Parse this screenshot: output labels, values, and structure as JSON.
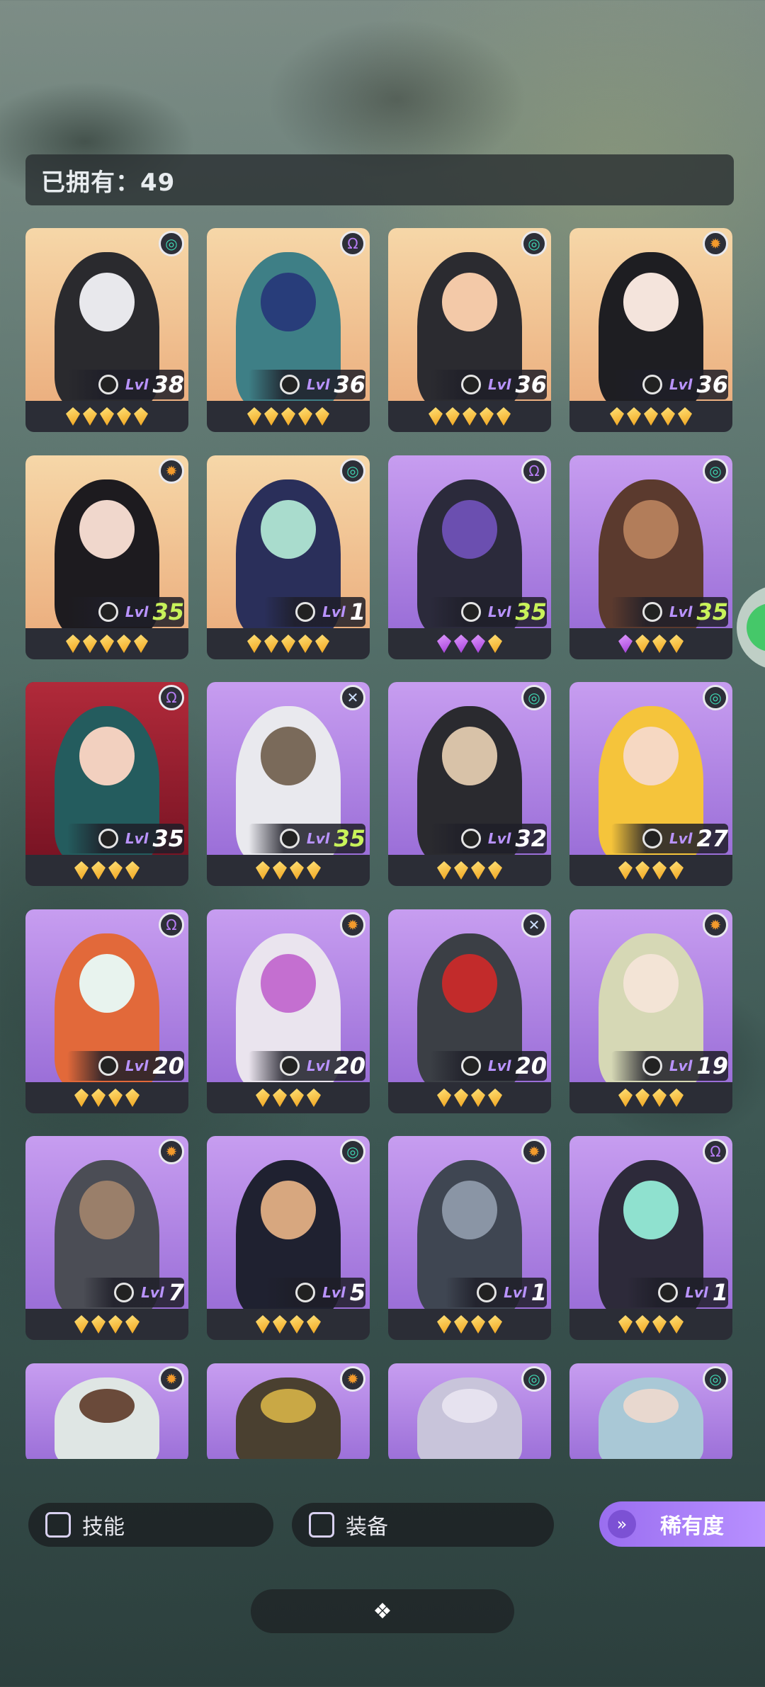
{
  "header": {
    "owned_text": "已拥有：49"
  },
  "cards": [
    {
      "element": "green",
      "level": "38",
      "hi": false,
      "gems": [
        "gold",
        "gold",
        "gold",
        "gold",
        "gold"
      ],
      "bg": [
        "#f6d7a8",
        "#ecb080"
      ],
      "fig": "#2a2a2e",
      "face": "#e8e8ec"
    },
    {
      "element": "purple",
      "level": "36",
      "hi": false,
      "gems": [
        "gold",
        "gold",
        "gold",
        "gold",
        "gold"
      ],
      "bg": [
        "#f6d7a8",
        "#ecb080"
      ],
      "fig": "#3e7f86",
      "face": "#283d7a"
    },
    {
      "element": "green",
      "level": "36",
      "hi": false,
      "gems": [
        "gold",
        "gold",
        "gold",
        "gold",
        "gold"
      ],
      "bg": [
        "#f6d7a8",
        "#ecb080"
      ],
      "fig": "#2b2b30",
      "face": "#f3c9a8"
    },
    {
      "element": "orange",
      "level": "36",
      "hi": false,
      "gems": [
        "gold",
        "gold",
        "gold",
        "gold",
        "gold"
      ],
      "bg": [
        "#f6d7a8",
        "#ecb080"
      ],
      "fig": "#1e1e22",
      "face": "#f4e4dc"
    },
    {
      "element": "orange",
      "level": "35",
      "hi": true,
      "gems": [
        "gold",
        "gold",
        "gold",
        "gold",
        "gold"
      ],
      "bg": [
        "#f6d7a8",
        "#ecb080"
      ],
      "fig": "#1d1b1f",
      "face": "#f0d7cc"
    },
    {
      "element": "green",
      "level": "1",
      "hi": false,
      "gems": [
        "gold",
        "gold",
        "gold",
        "gold",
        "gold"
      ],
      "bg": [
        "#f6d7a8",
        "#ecb080"
      ],
      "fig": "#2a2f5a",
      "face": "#a9dccd"
    },
    {
      "element": "purple",
      "level": "35",
      "hi": true,
      "gems": [
        "purple",
        "purple",
        "purple",
        "gold"
      ],
      "bg": [
        "#c79df0",
        "#9b6fd8"
      ],
      "fig": "#2b2a3b",
      "face": "#6b4fb0"
    },
    {
      "element": "green",
      "level": "35",
      "hi": true,
      "gems": [
        "purple",
        "gold",
        "gold",
        "gold"
      ],
      "bg": [
        "#c79df0",
        "#9b6fd8"
      ],
      "fig": "#5b3a2e",
      "face": "#b27d5a"
    },
    {
      "element": "purple",
      "level": "35",
      "hi": false,
      "gems": [
        "gold",
        "gold",
        "gold",
        "gold"
      ],
      "bg": [
        "#b12a3a",
        "#7a1424"
      ],
      "fig": "#245c5e",
      "face": "#f2d0bf"
    },
    {
      "element": "blue",
      "level": "35",
      "hi": true,
      "gems": [
        "gold",
        "gold",
        "gold",
        "gold"
      ],
      "bg": [
        "#c79df0",
        "#9b6fd8"
      ],
      "fig": "#e9e9ee",
      "face": "#7a6a5a"
    },
    {
      "element": "green",
      "level": "32",
      "hi": false,
      "gems": [
        "gold",
        "gold",
        "gold",
        "gold"
      ],
      "bg": [
        "#c79df0",
        "#9b6fd8"
      ],
      "fig": "#2a2a2f",
      "face": "#d8c2a8"
    },
    {
      "element": "green",
      "level": "27",
      "hi": false,
      "gems": [
        "gold",
        "gold",
        "gold",
        "gold"
      ],
      "bg": [
        "#c79df0",
        "#9b6fd8"
      ],
      "fig": "#f5c43b",
      "face": "#f6d8c2"
    },
    {
      "element": "purple",
      "level": "20",
      "hi": false,
      "gems": [
        "gold",
        "gold",
        "gold",
        "gold"
      ],
      "bg": [
        "#c79df0",
        "#9b6fd8"
      ],
      "fig": "#e2693a",
      "face": "#e8f3ee"
    },
    {
      "element": "orange",
      "level": "20",
      "hi": false,
      "gems": [
        "gold",
        "gold",
        "gold",
        "gold"
      ],
      "bg": [
        "#c79df0",
        "#9b6fd8"
      ],
      "fig": "#eae4ee",
      "face": "#c46fd0"
    },
    {
      "element": "blue",
      "level": "20",
      "hi": false,
      "gems": [
        "gold",
        "gold",
        "gold",
        "gold"
      ],
      "bg": [
        "#c79df0",
        "#9b6fd8"
      ],
      "fig": "#3b3f45",
      "face": "#c22b2b"
    },
    {
      "element": "orange",
      "level": "19",
      "hi": false,
      "gems": [
        "gold",
        "gold",
        "gold",
        "gold"
      ],
      "bg": [
        "#c79df0",
        "#9b6fd8"
      ],
      "fig": "#d6d8b5",
      "face": "#f3e4d6"
    },
    {
      "element": "orange",
      "level": "7",
      "hi": false,
      "gems": [
        "gold",
        "gold",
        "gold",
        "gold"
      ],
      "bg": [
        "#c79df0",
        "#9b6fd8"
      ],
      "fig": "#4b4d55",
      "face": "#9a7f6a"
    },
    {
      "element": "green",
      "level": "5",
      "hi": false,
      "gems": [
        "gold",
        "gold",
        "gold",
        "gold"
      ],
      "bg": [
        "#c79df0",
        "#9b6fd8"
      ],
      "fig": "#1f2130",
      "face": "#d7a77f"
    },
    {
      "element": "orange",
      "level": "1",
      "hi": false,
      "gems": [
        "gold",
        "gold",
        "gold",
        "gold"
      ],
      "bg": [
        "#c79df0",
        "#9b6fd8"
      ],
      "fig": "#3f4652",
      "face": "#8a95a5"
    },
    {
      "element": "purple",
      "level": "1",
      "hi": false,
      "gems": [
        "gold",
        "gold",
        "gold",
        "gold"
      ],
      "bg": [
        "#c79df0",
        "#9b6fd8"
      ],
      "fig": "#2d2a3a",
      "face": "#8fe1cf"
    },
    {
      "element": "orange",
      "level": "",
      "hi": false,
      "gems": [],
      "bg": [
        "#c79df0",
        "#9b6fd8"
      ],
      "fig": "#dfe6e4",
      "face": "#6a4a3a"
    },
    {
      "element": "orange",
      "level": "",
      "hi": false,
      "gems": [],
      "bg": [
        "#c79df0",
        "#9b6fd8"
      ],
      "fig": "#4a4030",
      "face": "#c9a845"
    },
    {
      "element": "green",
      "level": "",
      "hi": false,
      "gems": [],
      "bg": [
        "#c79df0",
        "#9b6fd8"
      ],
      "fig": "#c8c4da",
      "face": "#e6e2ef"
    },
    {
      "element": "green",
      "level": "",
      "hi": false,
      "gems": [],
      "bg": [
        "#c79df0",
        "#9b6fd8"
      ],
      "fig": "#a9c8d6",
      "face": "#e8d8cf"
    }
  ],
  "labels": {
    "level_prefix": "Lvl"
  },
  "filters": {
    "skill_label": "技能",
    "equip_label": "装备",
    "rarity_label": "稀有度"
  }
}
